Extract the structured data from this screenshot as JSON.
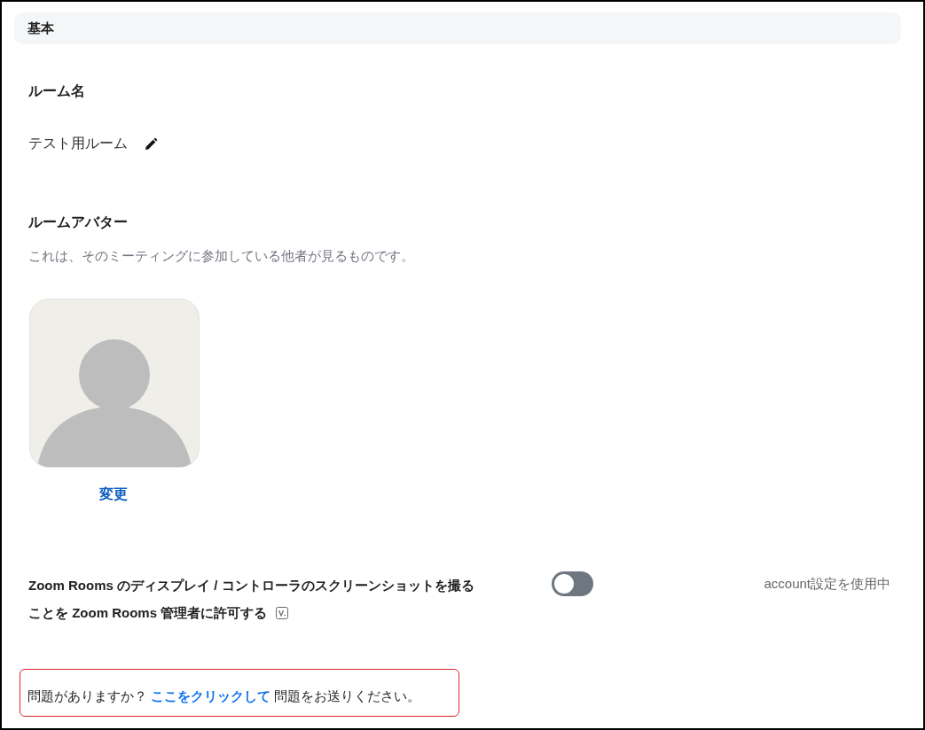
{
  "section": {
    "title": "基本"
  },
  "room_name": {
    "label": "ルーム名",
    "value": "テスト用ルーム"
  },
  "avatar": {
    "label": "ルームアバター",
    "description": "これは、そのミーティングに参加している他者が見るものです。",
    "change_link": "変更"
  },
  "setting": {
    "label_line1": "Zoom Rooms のディスプレイ / コントローラのスクリーンショットを撮る",
    "label_line2": "ことを Zoom Rooms 管理者に許可する",
    "on": false,
    "status": "account設定を使用中"
  },
  "feedback": {
    "before": "問題がありますか？",
    "link": "ここをクリックして",
    "after": "問題をお送りください。"
  }
}
